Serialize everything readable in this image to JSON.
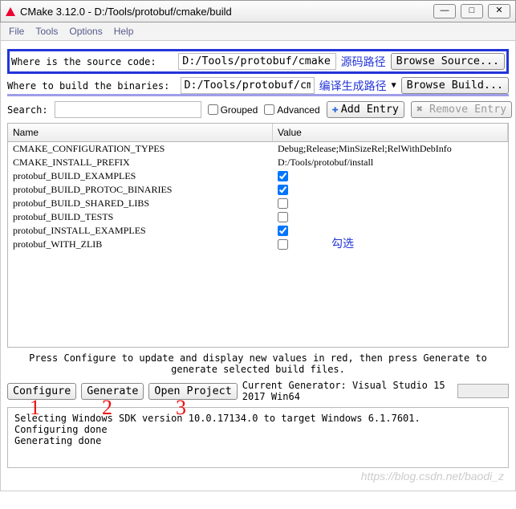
{
  "window": {
    "title": "CMake 3.12.0 - D:/Tools/protobuf/cmake/build",
    "minimize": "—",
    "maximize": "□",
    "close": "✕"
  },
  "menu": {
    "file": "File",
    "tools": "Tools",
    "options": "Options",
    "help": "Help"
  },
  "paths": {
    "source_label": "Where is the source code:   ",
    "source_value": "D:/Tools/protobuf/cmake",
    "build_label": "Where to build the binaries: ",
    "build_value": "D:/Tools/protobuf/cmake/build",
    "browse_source": "Browse Source...",
    "browse_build": "Browse Build..."
  },
  "annotations": {
    "source_cn": "源码路径",
    "build_cn": "编译生成路径",
    "check_cn": "勾选",
    "n1": "1",
    "n2": "2",
    "n3": "3"
  },
  "search": {
    "label": "Search:",
    "value": "",
    "grouped": "Grouped",
    "advanced": "Advanced",
    "add_entry": "Add Entry",
    "remove_entry": "Remove Entry"
  },
  "table": {
    "col_name": "Name",
    "col_value": "Value",
    "rows": [
      {
        "name": "CMAKE_CONFIGURATION_TYPES",
        "value": "Debug;Release;MinSizeRel;RelWithDebInfo",
        "type": "text"
      },
      {
        "name": "CMAKE_INSTALL_PREFIX",
        "value": "D:/Tools/protobuf/install",
        "type": "text"
      },
      {
        "name": "protobuf_BUILD_EXAMPLES",
        "value": true,
        "type": "bool"
      },
      {
        "name": "protobuf_BUILD_PROTOC_BINARIES",
        "value": true,
        "type": "bool"
      },
      {
        "name": "protobuf_BUILD_SHARED_LIBS",
        "value": false,
        "type": "bool"
      },
      {
        "name": "protobuf_BUILD_TESTS",
        "value": false,
        "type": "bool"
      },
      {
        "name": "protobuf_INSTALL_EXAMPLES",
        "value": true,
        "type": "bool"
      },
      {
        "name": "protobuf_WITH_ZLIB",
        "value": false,
        "type": "bool"
      }
    ]
  },
  "hint": "Press Configure to update and display new values in red, then press Generate to generate selected build files.",
  "bottom": {
    "configure": "Configure",
    "generate": "Generate",
    "open_project": "Open Project",
    "generator_info": "Current Generator: Visual Studio 15 2017 Win64"
  },
  "console": "Selecting Windows SDK version 10.0.17134.0 to target Windows 6.1.7601.\nConfiguring done\nGenerating done",
  "watermark": "https://blog.csdn.net/baodi_z"
}
